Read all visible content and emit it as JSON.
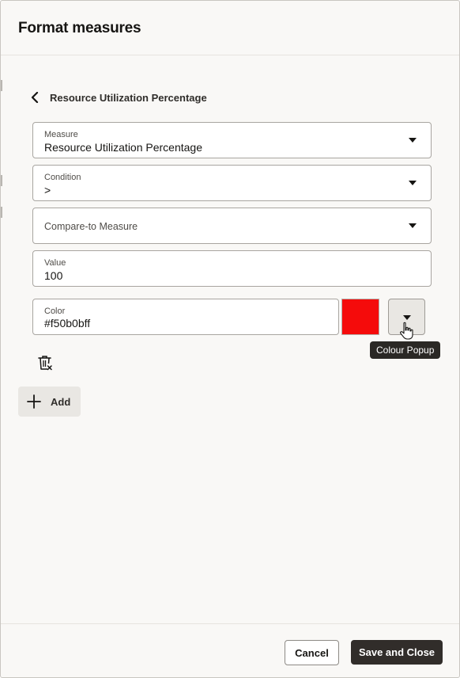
{
  "header": {
    "title": "Format measures"
  },
  "back": {
    "label": "Resource Utilization Percentage"
  },
  "form": {
    "measure": {
      "label": "Measure",
      "value": "Resource Utilization Percentage"
    },
    "condition": {
      "label": "Condition",
      "value": ">"
    },
    "compare_to": {
      "placeholder": "Compare-to Measure"
    },
    "value": {
      "label": "Value",
      "value": "100"
    },
    "color": {
      "label": "Color",
      "value": "#f50b0bff",
      "swatch_hex": "#f50b0b"
    },
    "colour_popup_tooltip": "Colour Popup"
  },
  "actions": {
    "add_label": "Add"
  },
  "footer": {
    "cancel_label": "Cancel",
    "save_label": "Save and Close"
  },
  "icons": {
    "back": "chevron-left-icon",
    "dropdown": "caret-down-icon",
    "delete": "trash-icon",
    "add": "plus-icon",
    "cursor": "hand-pointer-icon"
  },
  "colors": {
    "primary_button": "#312d2a",
    "panel_background": "#f9f8f6",
    "tooltip_background": "#2a2825"
  }
}
